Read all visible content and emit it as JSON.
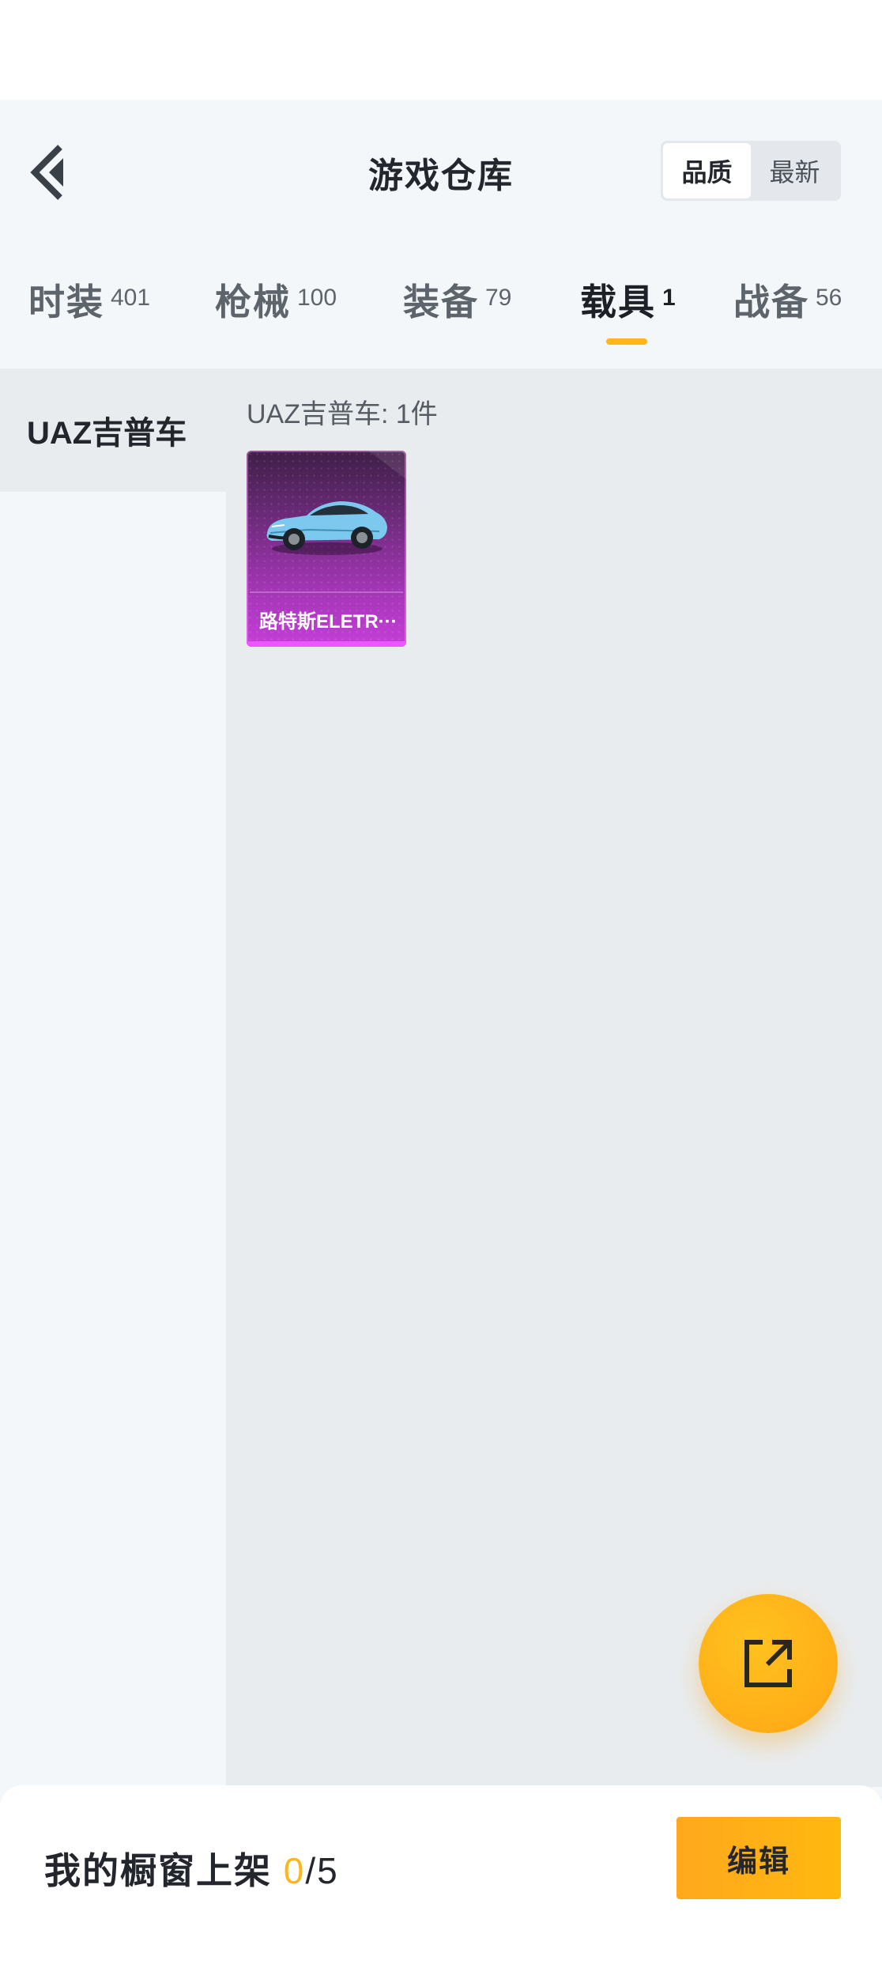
{
  "header": {
    "title": "游戏仓库",
    "sort_options": [
      "品质",
      "最新"
    ],
    "sort_selected": "品质"
  },
  "tabs": [
    {
      "label": "时装",
      "count": "401"
    },
    {
      "label": "枪械",
      "count": "100"
    },
    {
      "label": "装备",
      "count": "79"
    },
    {
      "label": "载具",
      "count": "1",
      "active": true
    },
    {
      "label": "战备",
      "count": "56"
    }
  ],
  "sidebar": {
    "items": [
      {
        "label": "UAZ吉普车",
        "selected": true
      }
    ]
  },
  "content": {
    "group_title": "UAZ吉普车: 1件",
    "items": [
      {
        "name": "路特斯ELETR···",
        "rarity_color": "#c53ed8"
      }
    ]
  },
  "bottom": {
    "label": "我的橱窗上架",
    "count_current": "0",
    "count_total": "/5",
    "edit_label": "编辑"
  },
  "colors": {
    "accent": "#ffb61a",
    "card_purple": "#a235b4",
    "text_dark": "#23272d"
  },
  "icons": [
    "back-arrow-icon",
    "share-external-icon",
    "car-image"
  ]
}
